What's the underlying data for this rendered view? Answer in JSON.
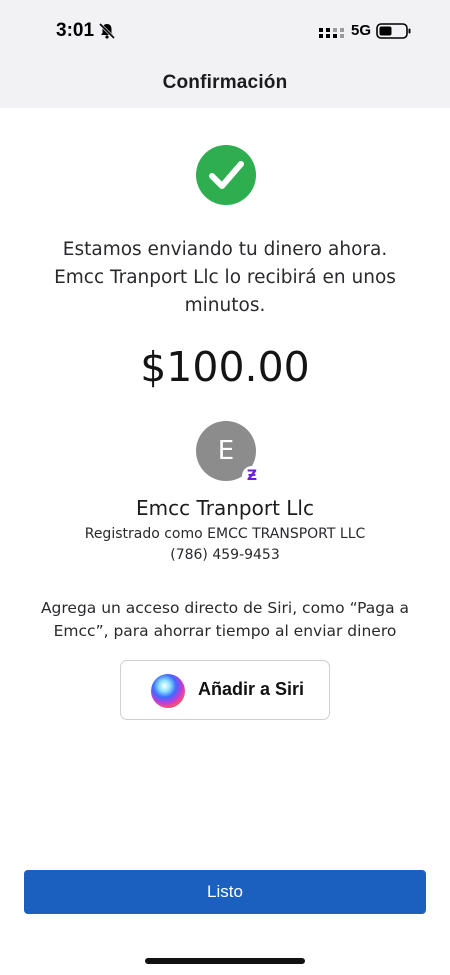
{
  "status_bar": {
    "time": "3:01",
    "network": "5G",
    "icons": [
      "bell-slash-icon",
      "signal-icon",
      "battery-icon"
    ]
  },
  "nav": {
    "title": "Confirmación"
  },
  "confirmation": {
    "icon": "checkmark-circle-icon",
    "icon_color": "#2eae4f",
    "message": "Estamos enviando tu dinero ahora. Emcc Tranport Llc lo recibirá en unos minutos.",
    "amount": "$100.00"
  },
  "recipient": {
    "avatar_initial": "E",
    "badge_icon": "zelle-icon",
    "name": "Emcc Tranport Llc",
    "registered_as": "Registrado como EMCC TRANSPORT LLC",
    "phone": "(786) 459-9453"
  },
  "siri": {
    "description": "Agrega un acceso directo de Siri, como “Paga a Emcc”, para ahorrar tiempo al enviar dinero",
    "button_label": "Añadir a Siri",
    "icon": "siri-icon"
  },
  "footer": {
    "done_label": "Listo",
    "accent_color": "#1b5fbf"
  }
}
